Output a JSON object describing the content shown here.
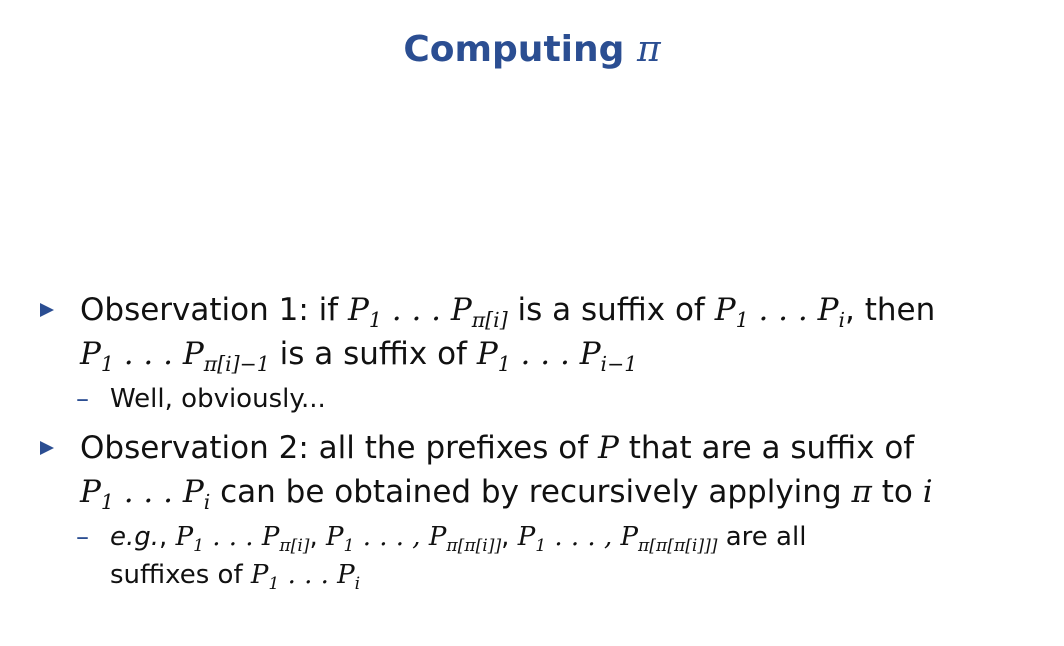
{
  "slide": {
    "title_text": "Computing",
    "title_symbol": "π"
  },
  "observation1": {
    "lead": "Observation 1: if",
    "mid": "is a suffix of",
    "tail": ", then",
    "line2_mid": "is a suffix of",
    "sub_point": "Well, obviously..."
  },
  "observation2": {
    "lead": "Observation 2: all the prefixes of",
    "var_p": "P",
    "after_p": "that are a suffix of",
    "line2_mid": "can be obtained by recursively applying",
    "pi": "π",
    "to": "to",
    "var_i": "i",
    "sub_eg": "e.g.",
    "sub_end": "are all",
    "sub_line2": "suffixes of"
  },
  "colors": {
    "accent": "#2b4e92",
    "text": "#111111",
    "background": "#ffffff"
  }
}
